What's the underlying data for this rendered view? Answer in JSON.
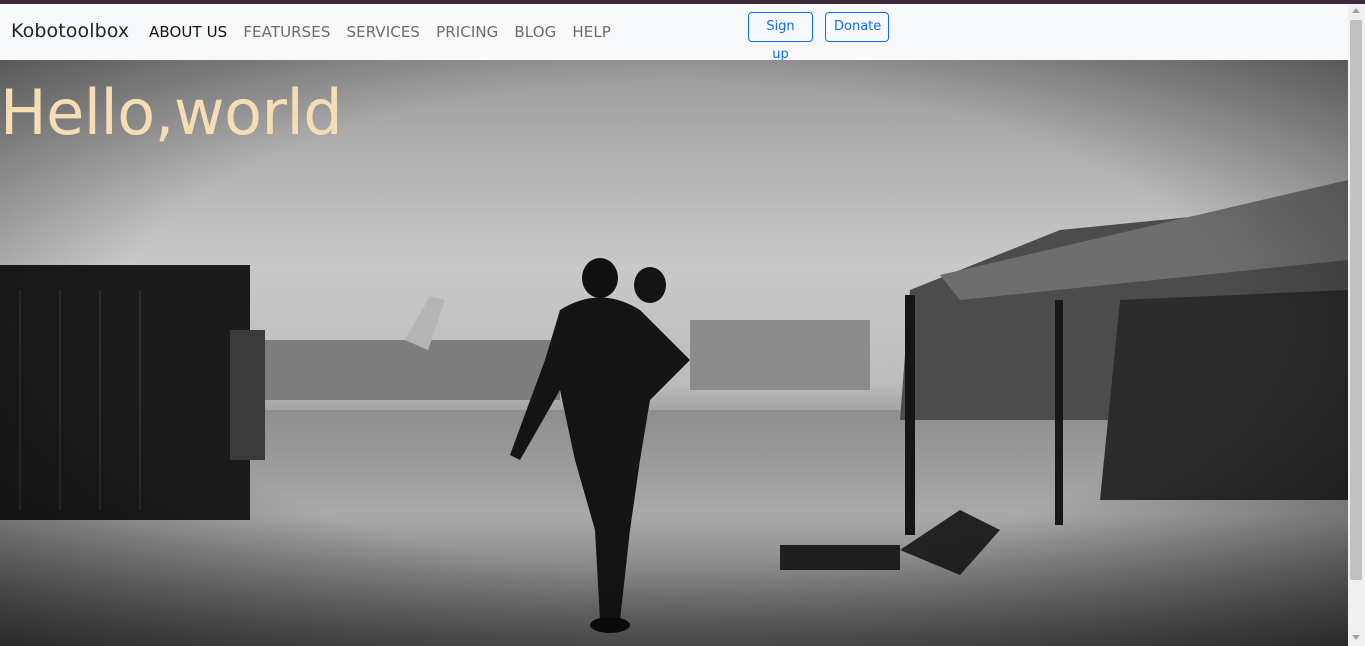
{
  "navbar": {
    "brand": "Kobotoolbox",
    "links": [
      "ABOUT US",
      "FEATURSES",
      "SERVICES",
      "PRICING",
      "BLOG",
      "HELP"
    ],
    "signup_label": "Sign up",
    "donate_label": "Donate",
    "button_color": "#0d6efd"
  },
  "hero": {
    "title": "Hello,world",
    "title_color": "#f5deb3",
    "image_description_icon": "photo-icon"
  }
}
